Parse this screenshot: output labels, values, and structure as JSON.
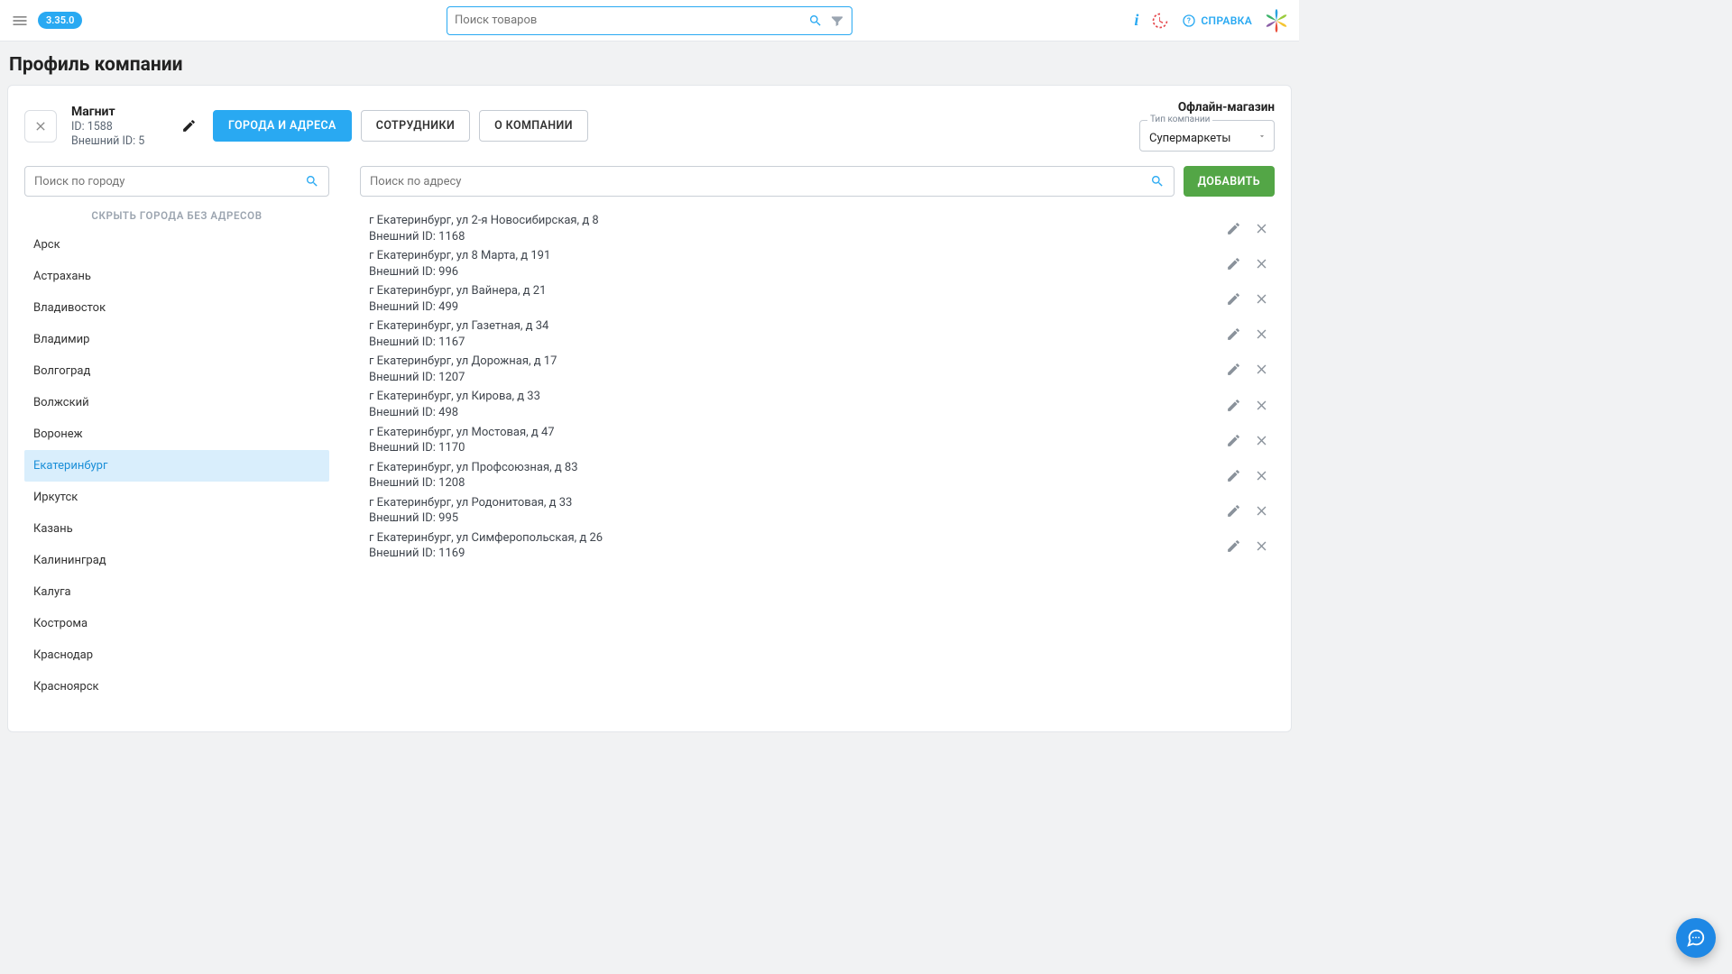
{
  "topbar": {
    "version": "3.35.0",
    "search_placeholder": "Поиск товаров",
    "help_label": "СПРАВКА"
  },
  "page": {
    "title": "Профиль компании"
  },
  "company": {
    "name": "Магнит",
    "id_label": "ID: 1588",
    "ext_id_label": "Внешний ID: 5",
    "store_type": "Офлайн-магазин",
    "type_select_label": "Тип компании",
    "type_select_value": "Супермаркеты"
  },
  "tabs": {
    "cities": "ГОРОДА И АДРЕСА",
    "staff": "СОТРУДНИКИ",
    "about": "О КОМПАНИИ"
  },
  "left": {
    "search_placeholder": "Поиск по городу",
    "hide_empty": "СКРЫТЬ ГОРОДА БЕЗ АДРЕСОВ",
    "cities": [
      "Арск",
      "Астрахань",
      "Владивосток",
      "Владимир",
      "Волгоград",
      "Волжский",
      "Воронеж",
      "Екатеринбург",
      "Иркутск",
      "Казань",
      "Калининград",
      "Калуга",
      "Кострома",
      "Краснодар",
      "Красноярск"
    ],
    "active_index": 7
  },
  "right": {
    "search_placeholder": "Поиск по адресу",
    "add_label": "ДОБАВИТЬ",
    "addresses": [
      {
        "line": "г Екатеринбург, ул 2-я Новосибирская, д 8",
        "ext": "Внешний ID: 1168"
      },
      {
        "line": "г Екатеринбург, ул 8 Марта, д 191",
        "ext": "Внешний ID: 996"
      },
      {
        "line": "г Екатеринбург, ул Вайнера, д 21",
        "ext": "Внешний ID: 499"
      },
      {
        "line": "г Екатеринбург, ул Газетная, д 34",
        "ext": "Внешний ID: 1167"
      },
      {
        "line": "г Екатеринбург, ул Дорожная, д 17",
        "ext": "Внешний ID: 1207"
      },
      {
        "line": "г Екатеринбург, ул Кирова, д 33",
        "ext": "Внешний ID: 498"
      },
      {
        "line": "г Екатеринбург, ул Мостовая, д 47",
        "ext": "Внешний ID: 1170"
      },
      {
        "line": "г Екатеринбург, ул Профсоюзная, д 83",
        "ext": "Внешний ID: 1208"
      },
      {
        "line": "г Екатеринбург, ул Родонитовая, д 33",
        "ext": "Внешний ID: 995"
      },
      {
        "line": "г Екатеринбург, ул Симферопольская, д 26",
        "ext": "Внешний ID: 1169"
      }
    ]
  }
}
